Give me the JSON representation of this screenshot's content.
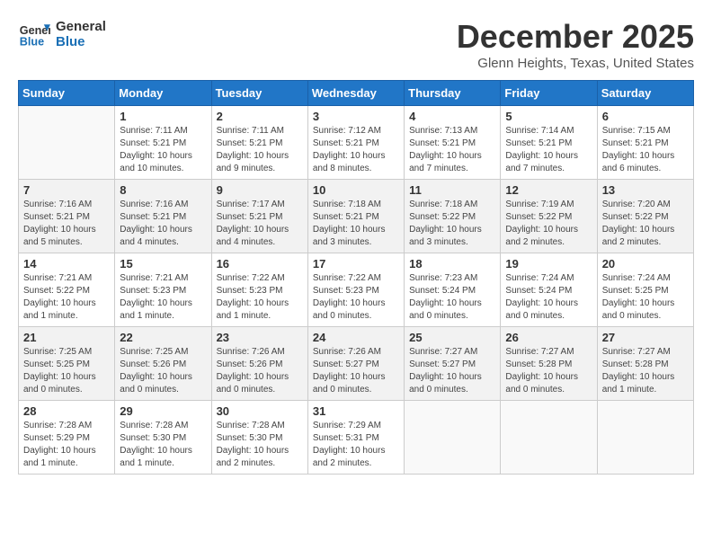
{
  "header": {
    "logo_line1": "General",
    "logo_line2": "Blue",
    "month": "December 2025",
    "location": "Glenn Heights, Texas, United States"
  },
  "days_of_week": [
    "Sunday",
    "Monday",
    "Tuesday",
    "Wednesday",
    "Thursday",
    "Friday",
    "Saturday"
  ],
  "weeks": [
    [
      {
        "day": "",
        "info": ""
      },
      {
        "day": "1",
        "info": "Sunrise: 7:11 AM\nSunset: 5:21 PM\nDaylight: 10 hours\nand 10 minutes."
      },
      {
        "day": "2",
        "info": "Sunrise: 7:11 AM\nSunset: 5:21 PM\nDaylight: 10 hours\nand 9 minutes."
      },
      {
        "day": "3",
        "info": "Sunrise: 7:12 AM\nSunset: 5:21 PM\nDaylight: 10 hours\nand 8 minutes."
      },
      {
        "day": "4",
        "info": "Sunrise: 7:13 AM\nSunset: 5:21 PM\nDaylight: 10 hours\nand 7 minutes."
      },
      {
        "day": "5",
        "info": "Sunrise: 7:14 AM\nSunset: 5:21 PM\nDaylight: 10 hours\nand 7 minutes."
      },
      {
        "day": "6",
        "info": "Sunrise: 7:15 AM\nSunset: 5:21 PM\nDaylight: 10 hours\nand 6 minutes."
      }
    ],
    [
      {
        "day": "7",
        "info": "Sunrise: 7:16 AM\nSunset: 5:21 PM\nDaylight: 10 hours\nand 5 minutes."
      },
      {
        "day": "8",
        "info": "Sunrise: 7:16 AM\nSunset: 5:21 PM\nDaylight: 10 hours\nand 4 minutes."
      },
      {
        "day": "9",
        "info": "Sunrise: 7:17 AM\nSunset: 5:21 PM\nDaylight: 10 hours\nand 4 minutes."
      },
      {
        "day": "10",
        "info": "Sunrise: 7:18 AM\nSunset: 5:21 PM\nDaylight: 10 hours\nand 3 minutes."
      },
      {
        "day": "11",
        "info": "Sunrise: 7:18 AM\nSunset: 5:22 PM\nDaylight: 10 hours\nand 3 minutes."
      },
      {
        "day": "12",
        "info": "Sunrise: 7:19 AM\nSunset: 5:22 PM\nDaylight: 10 hours\nand 2 minutes."
      },
      {
        "day": "13",
        "info": "Sunrise: 7:20 AM\nSunset: 5:22 PM\nDaylight: 10 hours\nand 2 minutes."
      }
    ],
    [
      {
        "day": "14",
        "info": "Sunrise: 7:21 AM\nSunset: 5:22 PM\nDaylight: 10 hours\nand 1 minute."
      },
      {
        "day": "15",
        "info": "Sunrise: 7:21 AM\nSunset: 5:23 PM\nDaylight: 10 hours\nand 1 minute."
      },
      {
        "day": "16",
        "info": "Sunrise: 7:22 AM\nSunset: 5:23 PM\nDaylight: 10 hours\nand 1 minute."
      },
      {
        "day": "17",
        "info": "Sunrise: 7:22 AM\nSunset: 5:23 PM\nDaylight: 10 hours\nand 0 minutes."
      },
      {
        "day": "18",
        "info": "Sunrise: 7:23 AM\nSunset: 5:24 PM\nDaylight: 10 hours\nand 0 minutes."
      },
      {
        "day": "19",
        "info": "Sunrise: 7:24 AM\nSunset: 5:24 PM\nDaylight: 10 hours\nand 0 minutes."
      },
      {
        "day": "20",
        "info": "Sunrise: 7:24 AM\nSunset: 5:25 PM\nDaylight: 10 hours\nand 0 minutes."
      }
    ],
    [
      {
        "day": "21",
        "info": "Sunrise: 7:25 AM\nSunset: 5:25 PM\nDaylight: 10 hours\nand 0 minutes."
      },
      {
        "day": "22",
        "info": "Sunrise: 7:25 AM\nSunset: 5:26 PM\nDaylight: 10 hours\nand 0 minutes."
      },
      {
        "day": "23",
        "info": "Sunrise: 7:26 AM\nSunset: 5:26 PM\nDaylight: 10 hours\nand 0 minutes."
      },
      {
        "day": "24",
        "info": "Sunrise: 7:26 AM\nSunset: 5:27 PM\nDaylight: 10 hours\nand 0 minutes."
      },
      {
        "day": "25",
        "info": "Sunrise: 7:27 AM\nSunset: 5:27 PM\nDaylight: 10 hours\nand 0 minutes."
      },
      {
        "day": "26",
        "info": "Sunrise: 7:27 AM\nSunset: 5:28 PM\nDaylight: 10 hours\nand 0 minutes."
      },
      {
        "day": "27",
        "info": "Sunrise: 7:27 AM\nSunset: 5:28 PM\nDaylight: 10 hours\nand 1 minute."
      }
    ],
    [
      {
        "day": "28",
        "info": "Sunrise: 7:28 AM\nSunset: 5:29 PM\nDaylight: 10 hours\nand 1 minute."
      },
      {
        "day": "29",
        "info": "Sunrise: 7:28 AM\nSunset: 5:30 PM\nDaylight: 10 hours\nand 1 minute."
      },
      {
        "day": "30",
        "info": "Sunrise: 7:28 AM\nSunset: 5:30 PM\nDaylight: 10 hours\nand 2 minutes."
      },
      {
        "day": "31",
        "info": "Sunrise: 7:29 AM\nSunset: 5:31 PM\nDaylight: 10 hours\nand 2 minutes."
      },
      {
        "day": "",
        "info": ""
      },
      {
        "day": "",
        "info": ""
      },
      {
        "day": "",
        "info": ""
      }
    ]
  ]
}
